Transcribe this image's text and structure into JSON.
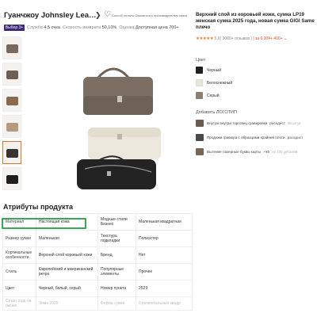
{
  "header": {
    "store_title": "Гуанчжоу Johnsley Leather Pro...",
    "chevron": "❯",
    "links": "Способ оплаты   Связаться с производителем   связи",
    "badge": "Выбор 3+ лет",
    "rating_label": "Служба",
    "rating_value": "4,5 очка",
    "speed_label": "Скорость возврата",
    "speed_value": "50,10%",
    "score_label": "Оценка",
    "score_value": "Доступная цена 700+"
  },
  "gallery": {
    "thumb_colors": [
      "#7a6a5d",
      "#6e5f55",
      "#8a6a4e",
      "#b49a80",
      "#3a3330",
      "#1e1e1e"
    ],
    "selected_index": 4
  },
  "product_info": {
    "section_title": "Атрибуты продукта",
    "rows": [
      {
        "k1": "Материал",
        "v1": "Настоящая кожа",
        "k2": "Модные стили Бизнес",
        "v2": "Маленькая квадратная"
      },
      {
        "k1": "Размер сумки",
        "v1": "Маленькая",
        "k2": "Текстура подкладки",
        "v2": "Полиэстер"
      },
      {
        "k1": "Кортикальные особенности",
        "v1": "Верхний слой коровьей кожи",
        "k2": "Бренд",
        "v2": "Нет"
      },
      {
        "k1": "Стиль",
        "v1": "Европейский и американский ретро",
        "k2": "Популярные элементы",
        "v2": "Прочее"
      },
      {
        "k1": "Цвет",
        "v1": "Черный, белый, серый",
        "k2": "Номер пункта",
        "v2": "2529"
      },
      {
        "k1": "Сезон года на рынке",
        "v1": "Зима 2025",
        "k2": "Форма сумки",
        "v2": "Горизонтальный квадр"
      }
    ]
  },
  "right": {
    "title": "Верхний слой из коровьей кожи, сумка LP19 женская сумка 2025 года, новая сумка GIGI Same плечо",
    "stars": "★★★★★",
    "rating": "5,0(  3000+ отзывов )",
    "price": "| за 6,00¥+ 400+ ⌄",
    "color_label": "Цвет",
    "colors": [
      {
        "name": "Черный",
        "swatch": "#1f1f1f"
      },
      {
        "name": "Белоснежный",
        "swatch": "#e9e4da"
      },
      {
        "name": "Серый",
        "swatch": "#8a7f76"
      }
    ],
    "engrave_label": "Добавить ЛОГОТИП",
    "engrave_options": [
      {
        "name": "Внутри внутри торговец гравировки",
        "price": "расадист",
        "moq": "30 штук"
      },
      {
        "name": "Продажи гравюра с образцами крайней плоти",
        "price": "расадист",
        "moq": ""
      },
      {
        "name": "Вытение лазерные буквы карты",
        "price": "+¥5",
        "moq": "из 100 деталей"
      }
    ]
  }
}
